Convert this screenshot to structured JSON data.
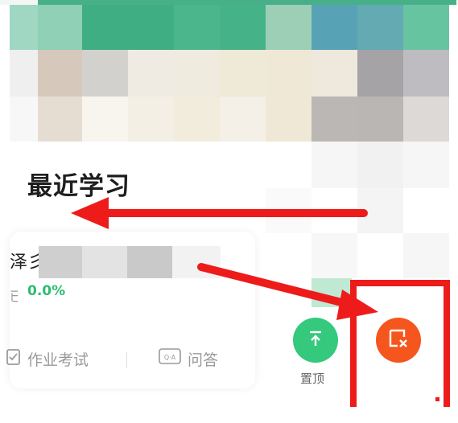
{
  "section": {
    "title": "最近学习"
  },
  "course": {
    "name": "泽彡",
    "label_prefix": "已",
    "progress": "0.0%",
    "actions": {
      "homework": "作业考试",
      "qa": "问答",
      "qa_icon_text": "Q·A"
    }
  },
  "swipe": {
    "pin_label": "置顶"
  },
  "colors": {
    "accent_green": "#34c97c",
    "progress_green": "#2dbd6e",
    "delete_orange": "#f5561e",
    "annotation_red": "#ee1b1b"
  },
  "icons": {
    "pin": "pin-top-icon",
    "delete": "delete-icon",
    "homework": "homework-icon",
    "qa": "qa-icon"
  }
}
